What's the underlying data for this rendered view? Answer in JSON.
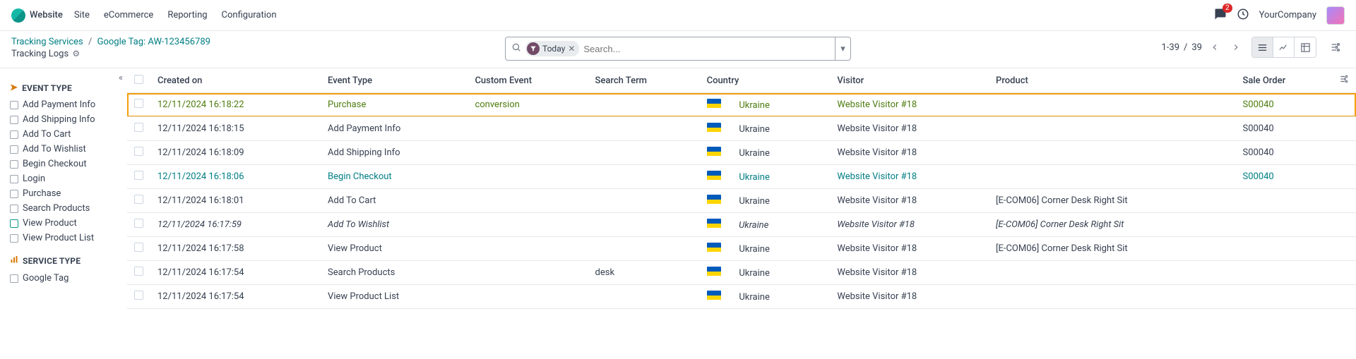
{
  "navbar": {
    "brand": "Website",
    "menu": [
      "Site",
      "eCommerce",
      "Reporting",
      "Configuration"
    ],
    "notif_count": "2",
    "company": "YourCompany"
  },
  "breadcrumb": {
    "root": "Tracking Services",
    "current": "Google Tag: AW-123456789",
    "title": "Tracking Logs"
  },
  "search": {
    "facet_label": "Today",
    "placeholder": "Search..."
  },
  "pager": {
    "range": "1-39",
    "sep": "/",
    "total": "39"
  },
  "sidebar": {
    "sec1_title": "EVENT TYPE",
    "sec1_items": [
      "Add Payment Info",
      "Add Shipping Info",
      "Add To Cart",
      "Add To Wishlist",
      "Begin Checkout",
      "Login",
      "Purchase",
      "Search Products",
      "View Product",
      "View Product List"
    ],
    "sec2_title": "SERVICE TYPE",
    "sec2_items": [
      "Google Tag"
    ]
  },
  "table": {
    "headers": {
      "created": "Created on",
      "event": "Event Type",
      "custom": "Custom Event",
      "term": "Search Term",
      "country": "Country",
      "visitor": "Visitor",
      "product": "Product",
      "sale": "Sale Order"
    },
    "rows": [
      {
        "created": "12/11/2024 16:18:22",
        "event": "Purchase",
        "custom": "conversion",
        "term": "",
        "country": "Ukraine",
        "visitor": "Website Visitor #18",
        "product": "",
        "sale": "S00040",
        "style": "highlight"
      },
      {
        "created": "12/11/2024 16:18:15",
        "event": "Add Payment Info",
        "custom": "",
        "term": "",
        "country": "Ukraine",
        "visitor": "Website Visitor #18",
        "product": "",
        "sale": "S00040",
        "style": ""
      },
      {
        "created": "12/11/2024 16:18:09",
        "event": "Add Shipping Info",
        "custom": "",
        "term": "",
        "country": "Ukraine",
        "visitor": "Website Visitor #18",
        "product": "",
        "sale": "S00040",
        "style": ""
      },
      {
        "created": "12/11/2024 16:18:06",
        "event": "Begin Checkout",
        "custom": "",
        "term": "",
        "country": "Ukraine",
        "visitor": "Website Visitor #18",
        "product": "",
        "sale": "S00040",
        "style": "link"
      },
      {
        "created": "12/11/2024 16:18:01",
        "event": "Add To Cart",
        "custom": "",
        "term": "",
        "country": "Ukraine",
        "visitor": "Website Visitor #18",
        "product": "[E-COM06] Corner Desk Right Sit",
        "sale": "",
        "style": ""
      },
      {
        "created": "12/11/2024 16:17:59",
        "event": "Add To Wishlist",
        "custom": "",
        "term": "",
        "country": "Ukraine",
        "visitor": "Website Visitor #18",
        "product": "[E-COM06] Corner Desk Right Sit",
        "sale": "",
        "style": "italic"
      },
      {
        "created": "12/11/2024 16:17:58",
        "event": "View Product",
        "custom": "",
        "term": "",
        "country": "Ukraine",
        "visitor": "Website Visitor #18",
        "product": "[E-COM06] Corner Desk Right Sit",
        "sale": "",
        "style": ""
      },
      {
        "created": "12/11/2024 16:17:54",
        "event": "Search Products",
        "custom": "",
        "term": "desk",
        "country": "Ukraine",
        "visitor": "Website Visitor #18",
        "product": "",
        "sale": "",
        "style": ""
      },
      {
        "created": "12/11/2024 16:17:54",
        "event": "View Product List",
        "custom": "",
        "term": "",
        "country": "Ukraine",
        "visitor": "Website Visitor #18",
        "product": "",
        "sale": "",
        "style": ""
      }
    ]
  }
}
